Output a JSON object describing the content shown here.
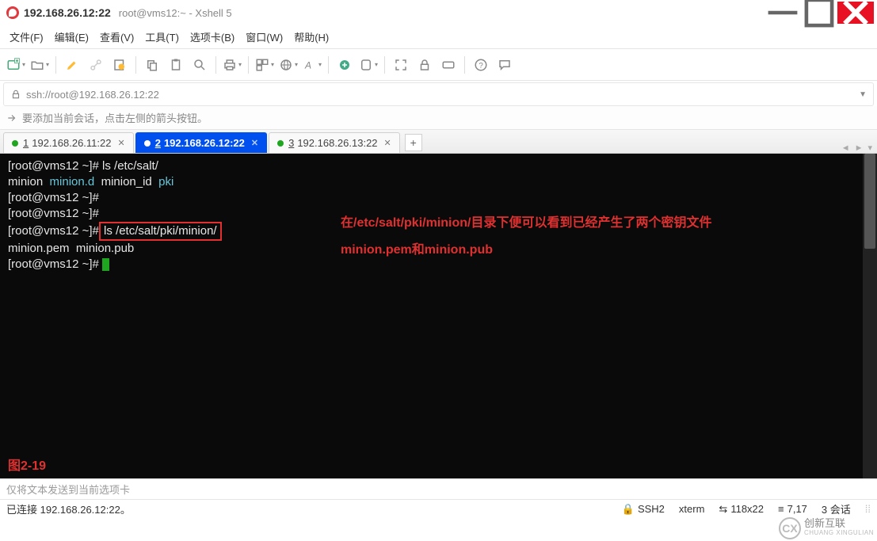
{
  "window": {
    "title_main": "192.168.26.12:22",
    "title_sub": "root@vms12:~ - Xshell 5"
  },
  "menu": {
    "file": "文件(F)",
    "edit": "编辑(E)",
    "view": "查看(V)",
    "tools": "工具(T)",
    "tabs": "选项卡(B)",
    "window": "窗口(W)",
    "help": "帮助(H)"
  },
  "address": {
    "url": "ssh://root@192.168.26.12:22"
  },
  "infobar": {
    "tip": "要添加当前会话，点击左侧的箭头按钮。"
  },
  "tabs": [
    {
      "index": "1",
      "label": "192.168.26.11:22",
      "active": false
    },
    {
      "index": "2",
      "label": "192.168.26.12:22",
      "active": true
    },
    {
      "index": "3",
      "label": "192.168.26.13:22",
      "active": false
    }
  ],
  "terminal": {
    "lines": [
      {
        "prompt": "[root@vms12 ~]# ",
        "cmd": "ls /etc/salt/"
      },
      {
        "raw_parts": [
          "minion  ",
          "minion.d",
          "  minion_id  ",
          "pki"
        ]
      },
      {
        "prompt": "[root@vms12 ~]# ",
        "cmd": ""
      },
      {
        "prompt": "[root@vms12 ~]# ",
        "cmd": ""
      },
      {
        "prompt": "[root@vms12 ~]# ",
        "cmd_hl": "ls /etc/salt/pki/minion/"
      },
      {
        "raw": "minion.pem  minion.pub"
      },
      {
        "prompt": "[root@vms12 ~]# ",
        "cursor": true
      }
    ],
    "annotation_top": "在/etc/salt/pki/minion/目录下便可以看到已经产生了两个密钥文件",
    "annotation_bottom": "minion.pem和minion.pub",
    "figure_label": "图2-19"
  },
  "sendbar": {
    "placeholder": "仅将文本发送到当前选项卡"
  },
  "status": {
    "connected": "已连接 192.168.26.12:22。",
    "protocol": "SSH2",
    "termtype": "xterm",
    "size": "118x22",
    "cursor": "7,17",
    "sessions": "3 会话"
  },
  "watermark": {
    "brand_cn": "创新互联",
    "brand_en": "CHUANG XINGULIAN"
  }
}
